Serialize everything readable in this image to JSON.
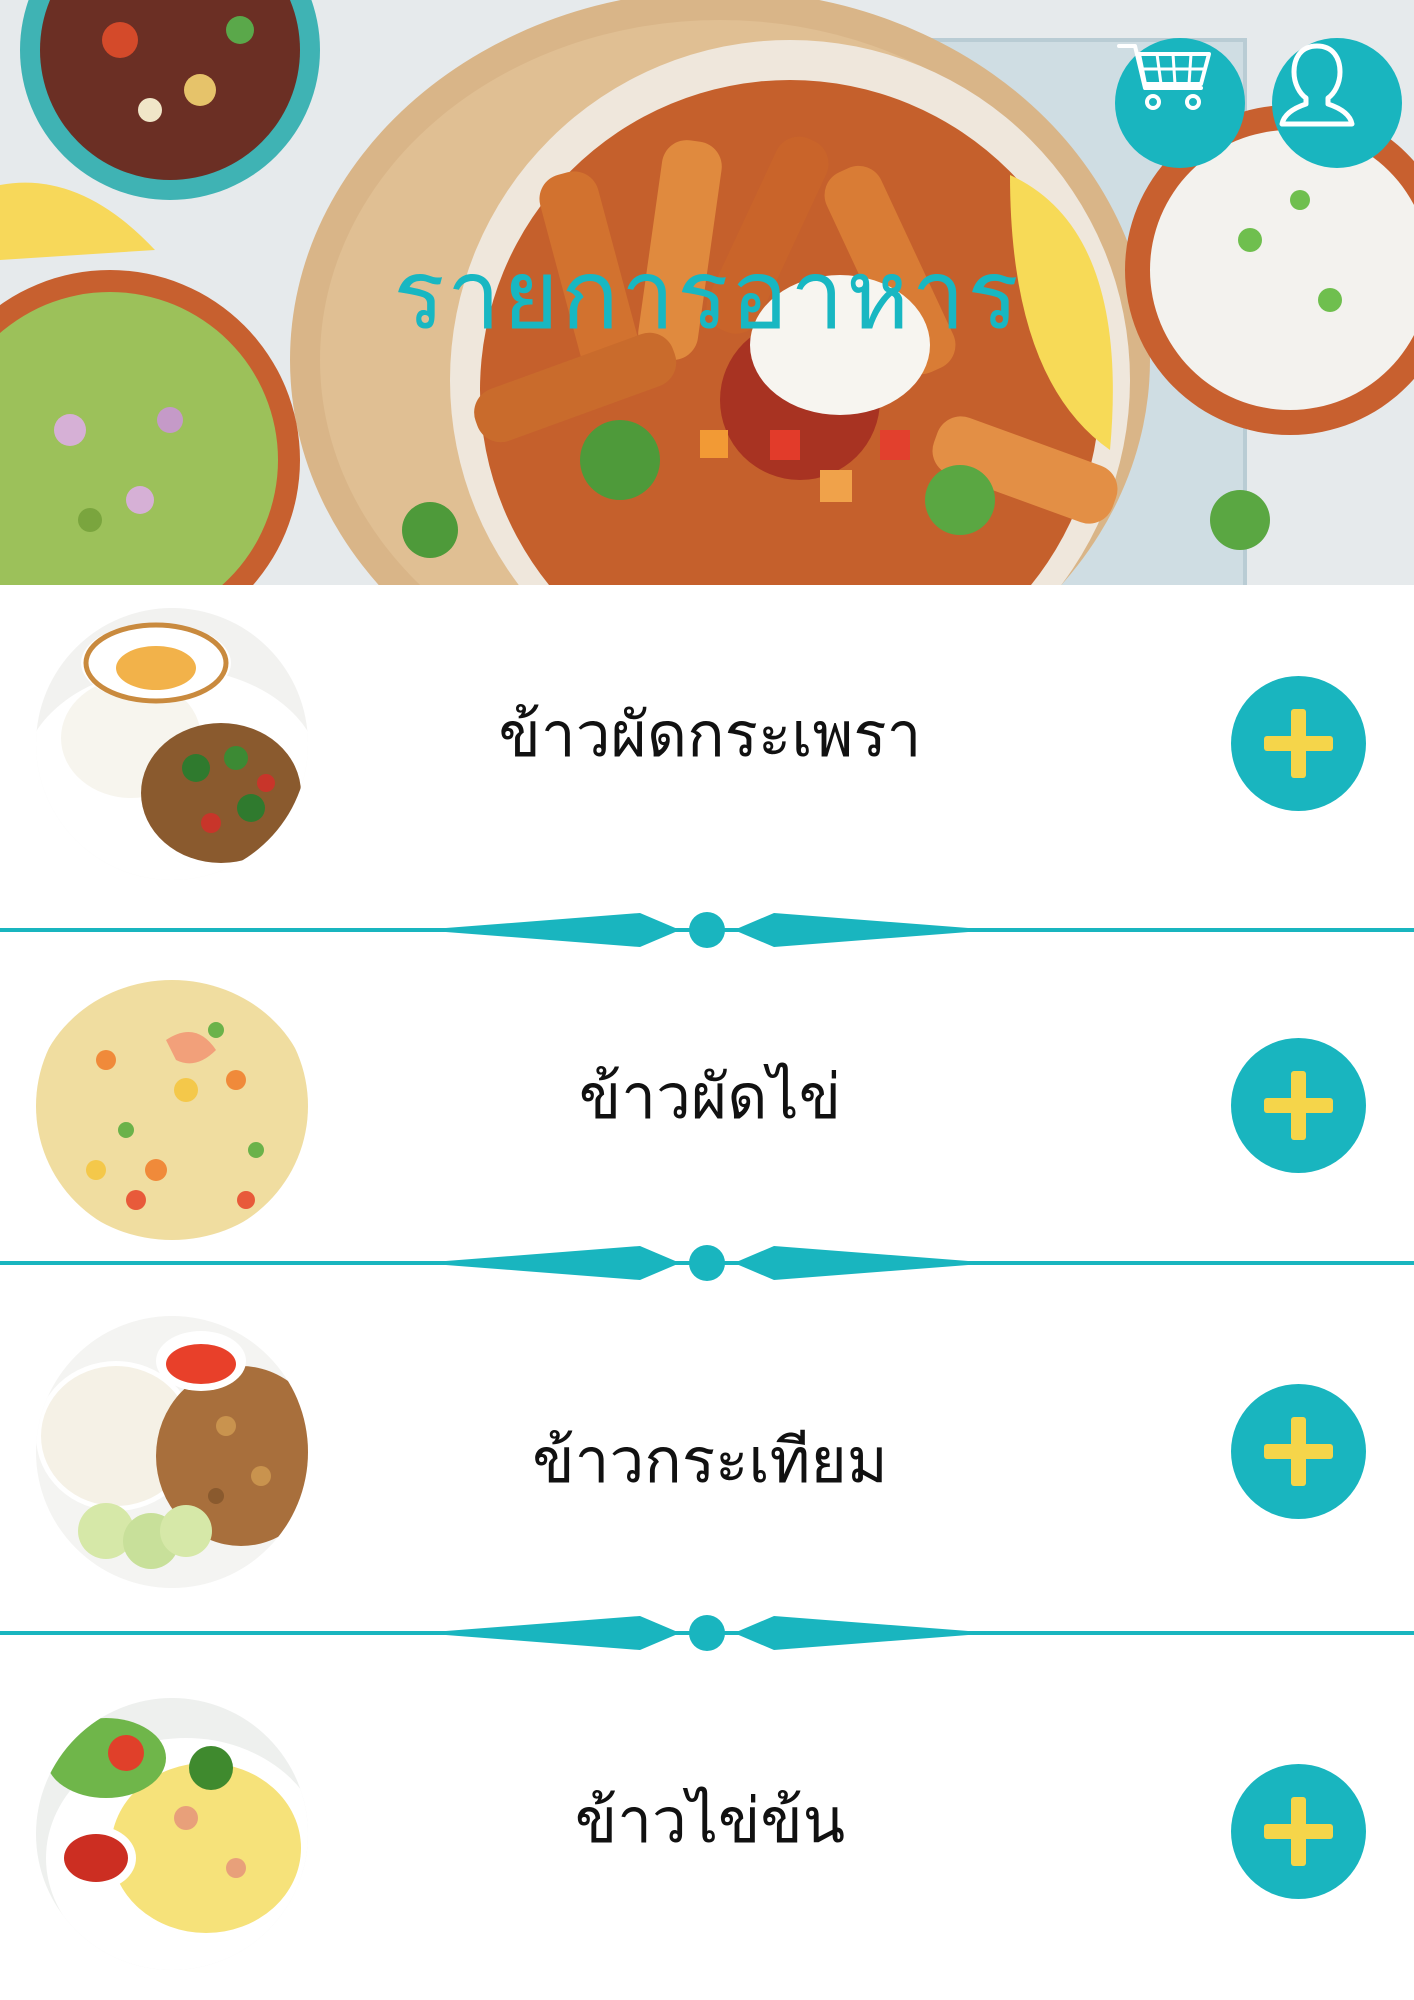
{
  "header": {
    "title": "รายการอาหาร",
    "cart_icon": "shopping-cart-icon",
    "profile_icon": "user-profile-icon"
  },
  "menu": {
    "items": [
      {
        "name": "ข้าวผัดกระเพรา",
        "image": "basil-pork-rice-with-fried-egg",
        "add_icon": "plus-icon"
      },
      {
        "name": "ข้าวผัดไข่",
        "image": "egg-fried-rice",
        "add_icon": "plus-icon"
      },
      {
        "name": "ข้าวกระเทียม",
        "image": "garlic-pork-rice",
        "add_icon": "plus-icon"
      },
      {
        "name": "ข้าวไข่ข้น",
        "image": "creamy-omelette-rice",
        "add_icon": "plus-icon"
      }
    ]
  },
  "colors": {
    "accent": "#19b5bf",
    "plus": "#f5d54a",
    "text": "#111111"
  }
}
